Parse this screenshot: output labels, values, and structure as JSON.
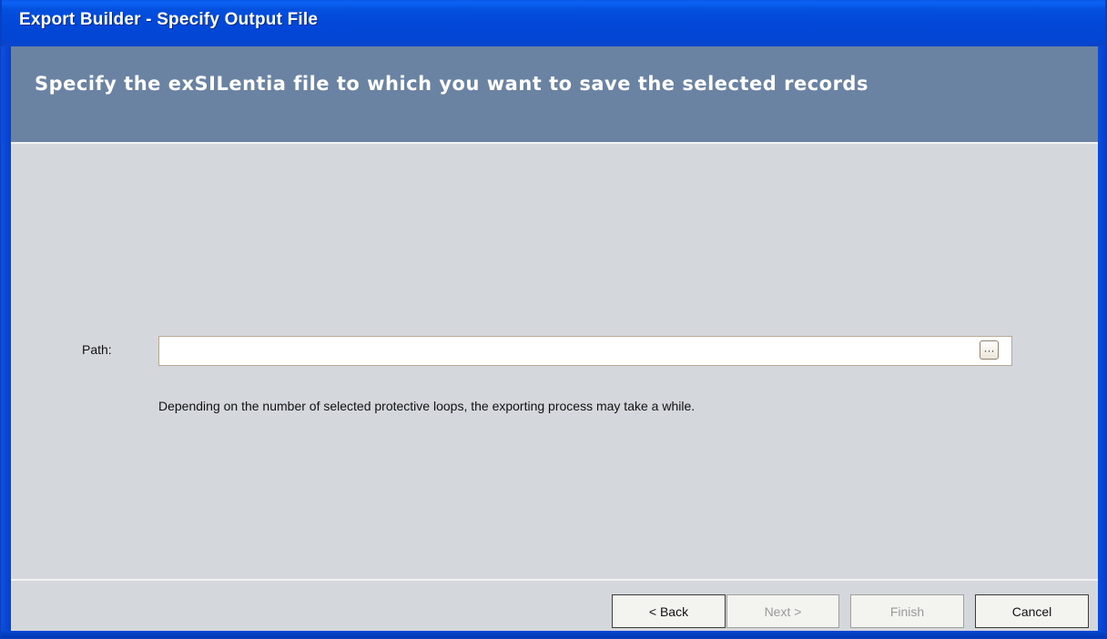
{
  "window": {
    "title": "Export Builder - Specify Output File"
  },
  "header": {
    "instruction": "Specify the exSILentia file to which you want to save the selected records"
  },
  "form": {
    "path_label": "Path:",
    "path_value": "",
    "path_placeholder": "",
    "browse_label": "···",
    "note": "Depending on the number of selected protective loops, the exporting process may take a while."
  },
  "footer": {
    "back_label": "< Back",
    "next_label": "Next >",
    "finish_label": "Finish",
    "cancel_label": "Cancel",
    "next_enabled": false,
    "finish_enabled": false
  },
  "colors": {
    "titlebar": "#0248d8",
    "header_band": "#6a83a3",
    "panel": "#d4d8dc"
  },
  "icons": {
    "browse": "ellipsis-icon"
  }
}
